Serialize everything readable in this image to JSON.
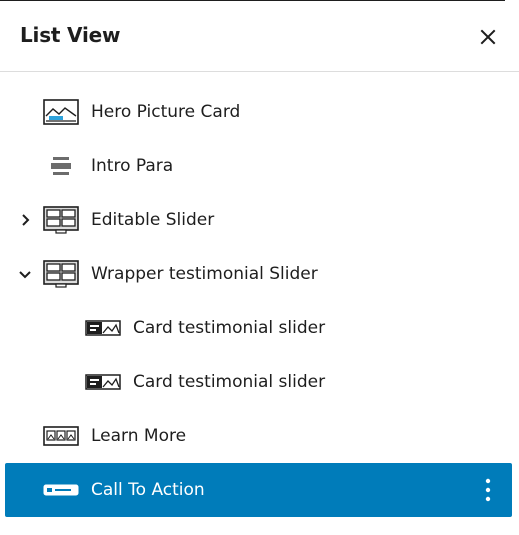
{
  "panel": {
    "title": "List View",
    "close_icon": "close-icon"
  },
  "tree": {
    "items": [
      {
        "label": "Hero Picture Card",
        "icon": "hero-picture-card-icon",
        "level": 1,
        "expandable": false
      },
      {
        "label": "Intro Para",
        "icon": "paragraph-icon",
        "level": 1,
        "expandable": false
      },
      {
        "label": "Editable Slider",
        "icon": "slider-icon",
        "level": 1,
        "expandable": true,
        "expanded": false
      },
      {
        "label": "Wrapper testimonial Slider",
        "icon": "slider-icon",
        "level": 1,
        "expandable": true,
        "expanded": true
      },
      {
        "label": "Card testimonial slider",
        "icon": "testimonial-card-icon",
        "level": 2,
        "expandable": false
      },
      {
        "label": "Card testimonial slider",
        "icon": "testimonial-card-icon",
        "level": 2,
        "expandable": false
      },
      {
        "label": "Learn More",
        "icon": "gallery-icon",
        "level": 1,
        "expandable": false
      },
      {
        "label": "Call To Action",
        "icon": "button-icon",
        "level": 1,
        "expandable": false,
        "selected": true
      }
    ]
  },
  "colors": {
    "selected_bg": "#007cba",
    "text": "#1e1e1e",
    "accent_icon": "#2ea3dc"
  }
}
